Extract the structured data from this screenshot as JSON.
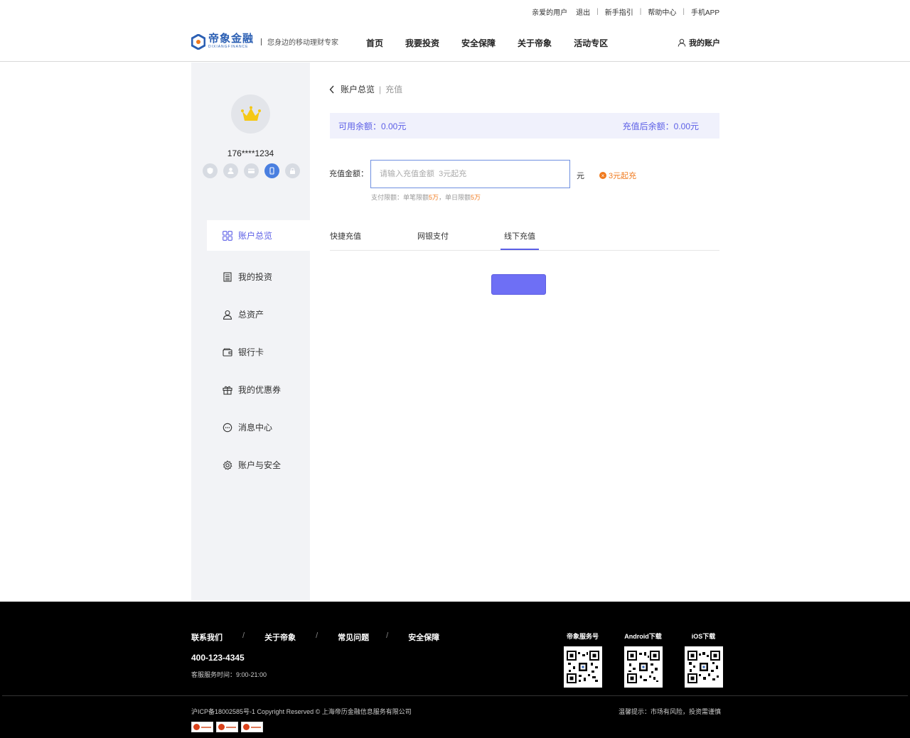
{
  "toplinks": {
    "greeting": "亲爱的用户",
    "logout": "退出",
    "guide": "新手指引",
    "help": "帮助中心",
    "app": "手机APP"
  },
  "logo": {
    "name": "帝象金融",
    "en": "DIXIANGFINANCE",
    "slogan": "您身边的移动理财专家"
  },
  "nav": [
    "首页",
    "我要投资",
    "安全保障",
    "关于帝象",
    "活动专区"
  ],
  "account_link": "我的账户",
  "user": {
    "phone": "176****1234"
  },
  "sidebar": {
    "items": [
      {
        "label": "账户总览",
        "icon": "grid-icon"
      },
      {
        "label": "我的投资",
        "icon": "document-icon"
      },
      {
        "label": "总资产",
        "icon": "user-icon"
      },
      {
        "label": "银行卡",
        "icon": "wallet-icon"
      },
      {
        "label": "我的优惠券",
        "icon": "gift-icon"
      },
      {
        "label": "消息中心",
        "icon": "message-icon"
      },
      {
        "label": "账户与安全",
        "icon": "gear-icon"
      }
    ]
  },
  "breadcrumb": {
    "root": "账户总览",
    "sep": "|",
    "current": "充值"
  },
  "balance": {
    "available": "可用余额：0.00元",
    "after": "充值后余额：0.00元"
  },
  "recharge": {
    "label": "充值金额：",
    "placeholder": "请输入充值金额  3元起充",
    "unit": "元",
    "hint": "3元起充",
    "limit_prefix": "支付限额：单笔限额",
    "limit_single": "5万",
    "limit_mid": "，单日限额",
    "limit_daily": "5万"
  },
  "tabs": [
    "快捷充值",
    "网银支付",
    "线下充值"
  ],
  "active_tab": 2,
  "footer": {
    "links": [
      "联系我们",
      "关于帝象",
      "常见问题",
      "安全保障"
    ],
    "sep": "/",
    "hotline": "400-123-4345",
    "hours": "客服服务时间：9:00-21:00",
    "qrs": [
      "帝象服务号",
      "Android下载",
      "iOS下载"
    ],
    "copyright": "沪ICP备18002585号-1 Copyright Reserved © 上海帝历金融信息服务有限公司",
    "warning": "温馨提示：市场有风险，投资需谨慎"
  },
  "colors": {
    "accent": "#5b5ee6",
    "button": "#6e6ff5",
    "warning": "#f07a1e",
    "brand": "#2b5fb3"
  }
}
